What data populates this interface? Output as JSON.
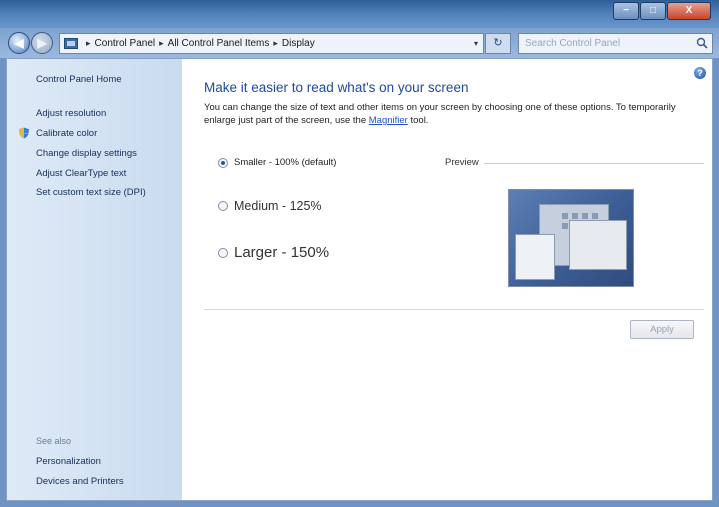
{
  "titlebar": {
    "minimize_glyph": "−",
    "maximize_glyph": "□",
    "close_glyph": "X"
  },
  "nav": {
    "back_glyph": "◀",
    "forward_glyph": "▶",
    "breadcrumb": [
      "Control Panel",
      "All Control Panel Items",
      "Display"
    ],
    "separator": "▸",
    "dropdown_glyph": "▾",
    "refresh_glyph": "↻",
    "search_placeholder": "Search Control Panel"
  },
  "sidebar": {
    "home": "Control Panel Home",
    "links": [
      "Adjust resolution",
      "Calibrate color",
      "Change display settings",
      "Adjust ClearType text",
      "Set custom text size (DPI)"
    ],
    "see_also": "See also",
    "see_also_links": [
      "Personalization",
      "Devices and Printers"
    ]
  },
  "main": {
    "help_glyph": "?",
    "title": "Make it easier to read what's on your screen",
    "description_before": "You can change the size of text and other items on your screen by choosing one of these options. To temporarily enlarge just part of the screen, use the ",
    "description_link": "Magnifier",
    "description_after": " tool.",
    "options": [
      {
        "label": "Smaller - 100% (default)",
        "selected": true
      },
      {
        "label": "Medium - 125%",
        "selected": false
      },
      {
        "label": "Larger - 150%",
        "selected": false
      }
    ],
    "preview_label": "Preview",
    "apply_label": "Apply"
  },
  "colors": {
    "accent": "#1e4aa0",
    "link": "#1b55c8",
    "sidebar_bg": "#d6e4f4"
  },
  "icons": {
    "shield": "shield-icon",
    "search": "search-icon",
    "help": "help-icon"
  }
}
